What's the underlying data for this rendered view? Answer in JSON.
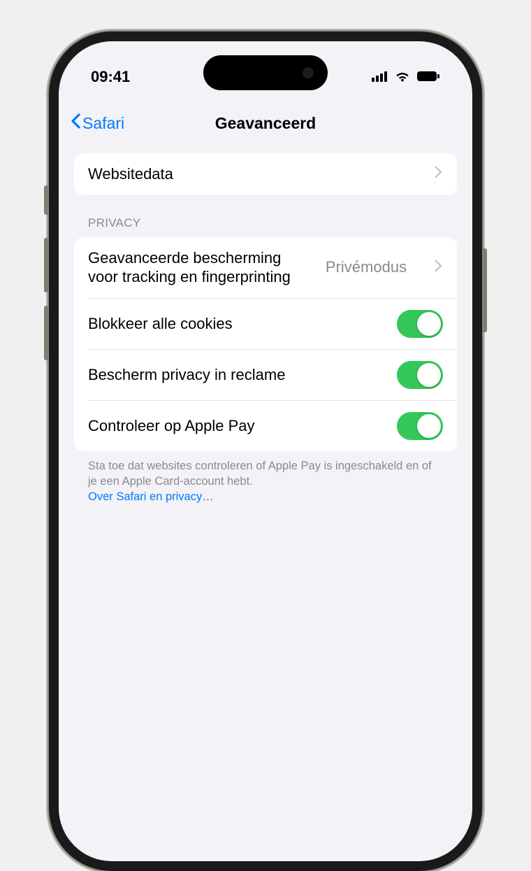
{
  "status": {
    "time": "09:41"
  },
  "nav": {
    "back": "Safari",
    "title": "Geavanceerd"
  },
  "group1": {
    "websitedata": "Websitedata"
  },
  "privacy": {
    "header": "PRIVACY",
    "tracking_label": "Geavanceerde bescherming voor tracking en fingerprinting",
    "tracking_value": "Privémodus",
    "block_cookies": "Blokkeer alle cookies",
    "ad_privacy": "Bescherm privacy in reclame",
    "apple_pay": "Controleer op Apple Pay",
    "footer": "Sta toe dat websites controleren of Apple Pay is ingeschakeld en of je een Apple Card-account hebt.",
    "footer_link": "Over Safari en privacy…"
  },
  "toggles": {
    "block_cookies": true,
    "ad_privacy": true,
    "apple_pay": true
  }
}
